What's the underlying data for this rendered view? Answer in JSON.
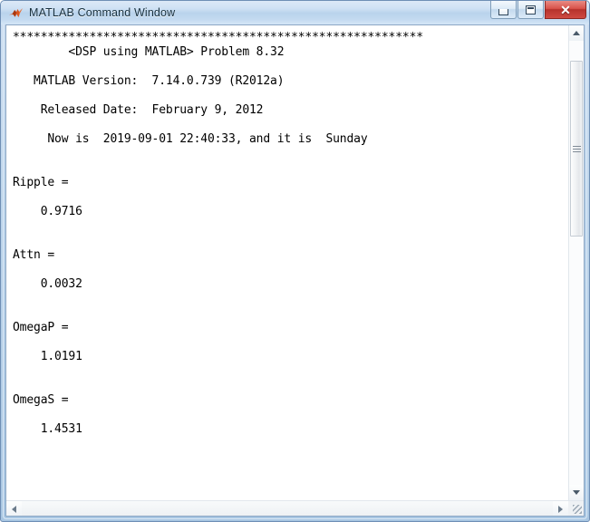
{
  "window": {
    "title": "MATLAB Command Window",
    "icon": "matlab-membrane-icon",
    "controls": {
      "minimize_label": "–",
      "maximize_label": "□",
      "close_label": "✕"
    }
  },
  "console": {
    "lines": [
      "***********************************************************",
      "        <DSP using MATLAB> Problem 8.32",
      "",
      "   MATLAB Version:  7.14.0.739 (R2012a)",
      "",
      "    Released Date:  February 9, 2012",
      "",
      "     Now is  2019-09-01 22:40:33, and it is  Sunday",
      "",
      "",
      "Ripple =",
      "",
      "    0.9716",
      "",
      "",
      "Attn =",
      "",
      "    0.0032",
      "",
      "",
      "OmegaP =",
      "",
      "    1.0191",
      "",
      "",
      "OmegaS =",
      "",
      "    1.4531",
      ""
    ],
    "banner": "***********************************************************",
    "program_title": "<DSP using MATLAB> Problem 8.32",
    "version_label": "MATLAB Version:",
    "version_value": "7.14.0.739 (R2012a)",
    "released_label": "Released Date:",
    "released_value": "February 9, 2012",
    "timestamp_line": "Now is  2019-09-01 22:40:33, and it is  Sunday",
    "variables": [
      {
        "name": "Ripple",
        "value": "0.9716"
      },
      {
        "name": "Attn",
        "value": "0.0032"
      },
      {
        "name": "OmegaP",
        "value": "1.0191"
      },
      {
        "name": "OmegaS",
        "value": "1.4531"
      }
    ]
  },
  "scrollbars": {
    "vertical": {
      "up_icon": "arrow-up-icon",
      "down_icon": "arrow-down-icon",
      "thumb": "vertical-scroll-thumb"
    },
    "horizontal": {
      "left_icon": "arrow-left-icon",
      "right_icon": "arrow-right-icon"
    },
    "resize_grip": "resize-grip-icon"
  },
  "colors": {
    "titlebar_top": "#dce9f7",
    "titlebar_bottom": "#d5e6f7",
    "frame": "#a8c6e2",
    "close_button": "#b6322c",
    "text": "#000000",
    "console_background": "#ffffff"
  }
}
